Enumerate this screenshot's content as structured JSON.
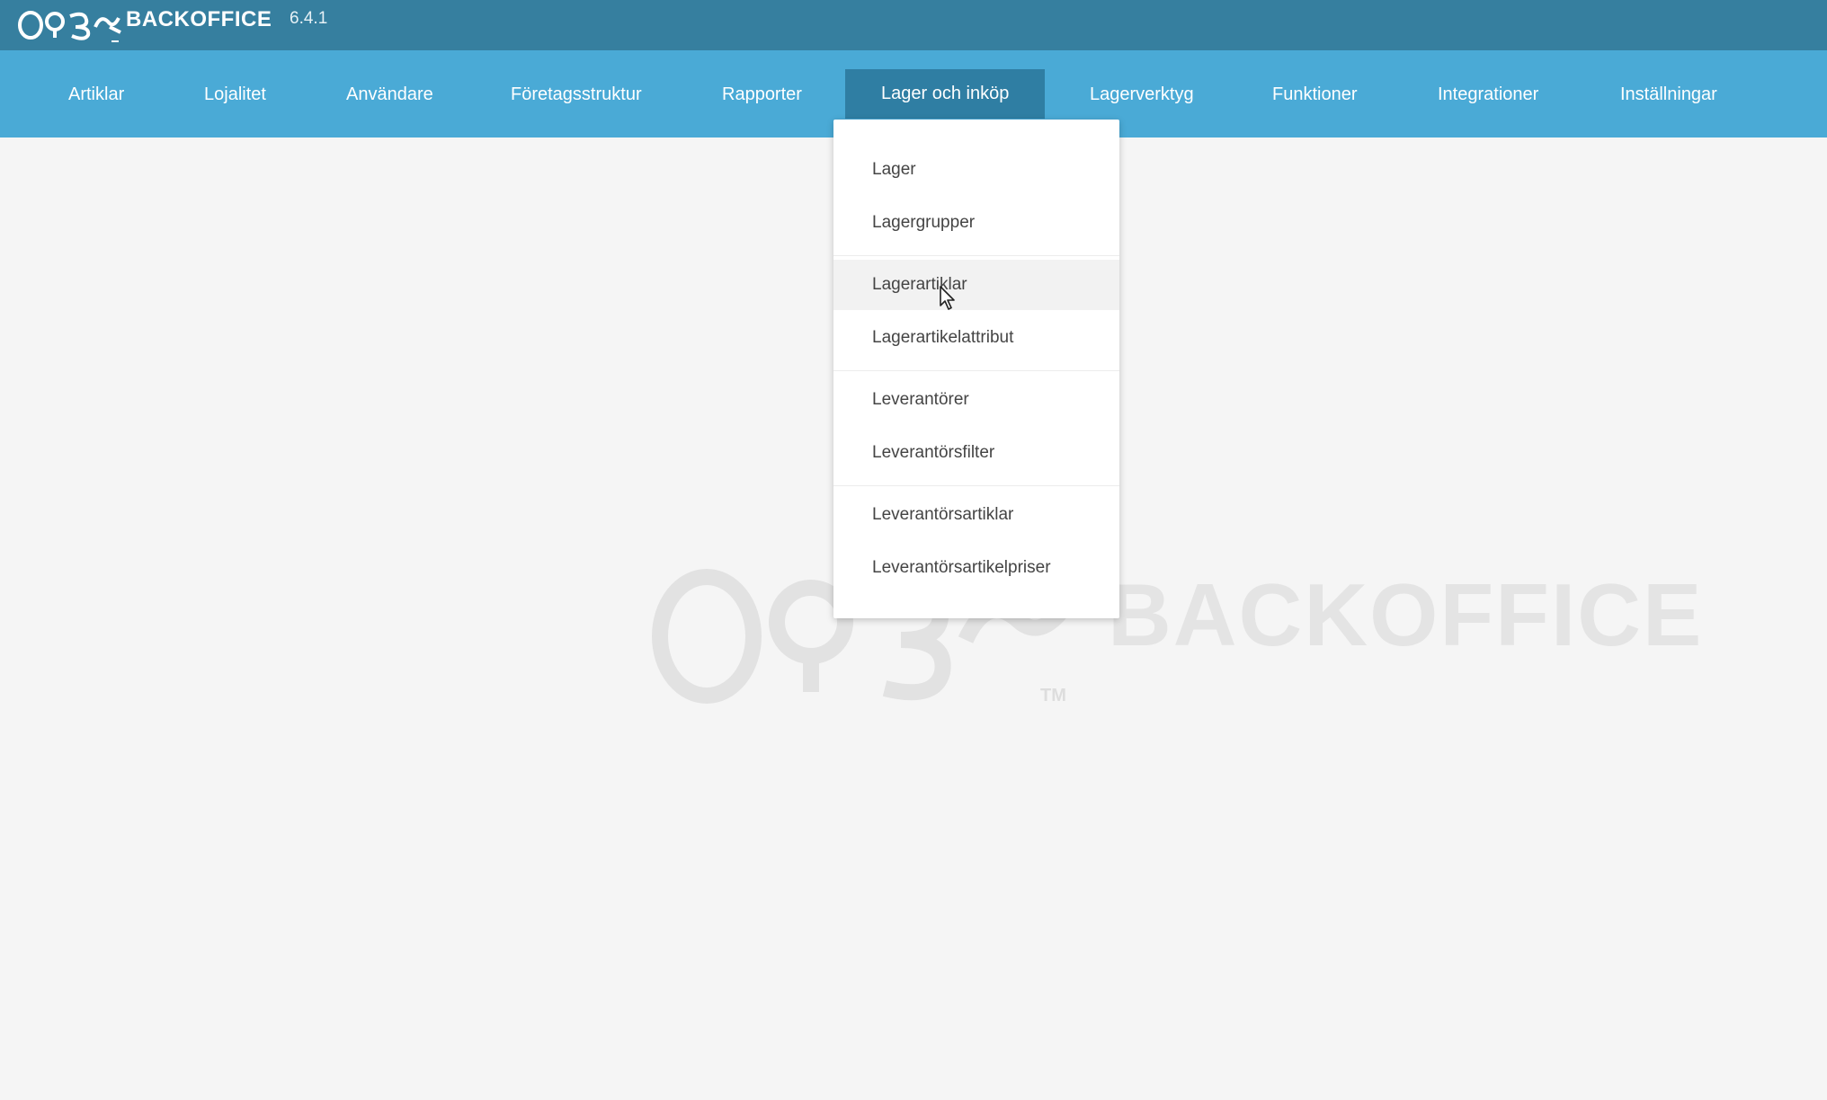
{
  "header": {
    "brand": "BACKOFFICE",
    "version": "6.4.1",
    "logo_icon": "open390-logo-icon",
    "background_color": "#367f9f"
  },
  "nav": {
    "background_color": "#4aaad6",
    "active_color": "#2f7ea3",
    "items": [
      {
        "label": "Artiklar"
      },
      {
        "label": "Lojalitet"
      },
      {
        "label": "Användare"
      },
      {
        "label": "Företagsstruktur"
      },
      {
        "label": "Rapporter"
      },
      {
        "label": "Lager och inköp",
        "active": true
      },
      {
        "label": "Lagerverktyg"
      },
      {
        "label": "Funktioner"
      },
      {
        "label": "Integrationer"
      },
      {
        "label": "Inställningar"
      }
    ]
  },
  "dropdown": {
    "items": [
      {
        "label": "Lager"
      },
      {
        "label": "Lagergrupper"
      },
      {
        "label": "Lagerartiklar",
        "hovered": true
      },
      {
        "label": "Lagerartikelattribut"
      },
      {
        "label": "Leverantörer"
      },
      {
        "label": "Leverantörsfilter"
      },
      {
        "label": "Leverantörsartiklar"
      },
      {
        "label": "Leverantörsartikelpriser"
      }
    ]
  },
  "watermark": {
    "text": "BACKOFFICE",
    "trademark": "TM"
  }
}
